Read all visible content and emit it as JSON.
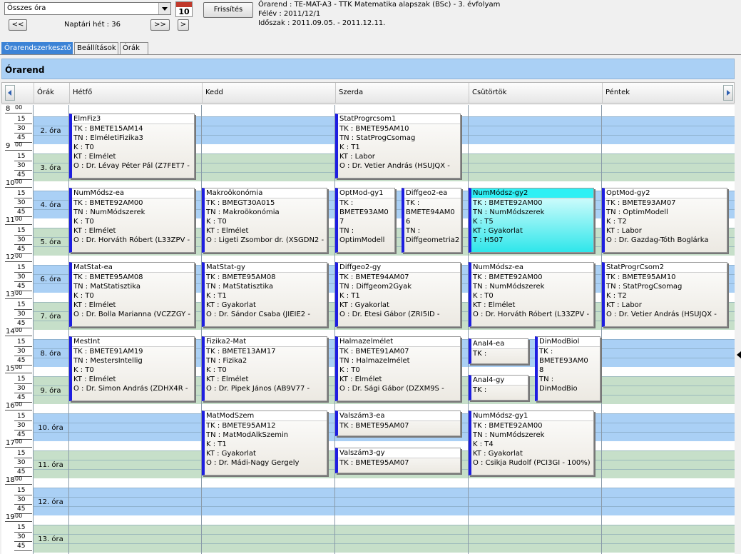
{
  "toolbar": {
    "filter_value": "Összes óra",
    "calendar_day": "10",
    "refresh_label": "Frissítés",
    "prev_label": "<<",
    "week_label": "Naptári hét : 36",
    "next_label": ">>",
    "next_small_label": ">"
  },
  "info": {
    "line1": "Órarend : TE-MAT-A3 - TTK Matematika alapszak (BSc) - 3. évfolyam",
    "line2": "Félév : 2011/12/1",
    "line3": "Időszak : 2011.09.05. - 2011.12.11."
  },
  "tabs": [
    "Órarendszerkesztő",
    "Beállítások",
    "Órák"
  ],
  "title": "Órarend",
  "header": {
    "col_orak": "Órák",
    "days": [
      "Hétfő",
      "Kedd",
      "Szerda",
      "Csütörtök",
      "Péntek"
    ]
  },
  "hours": [
    "8",
    "9",
    "10",
    "11",
    "12",
    "13",
    "14",
    "15",
    "16",
    "17",
    "18",
    "19"
  ],
  "minute_labels": {
    "zero": "00",
    "q1": "15",
    "q2": "30",
    "q3": "45"
  },
  "orak": [
    "2. óra",
    "3. óra",
    "4. óra",
    "5. óra",
    "6. óra",
    "7. óra",
    "8. óra",
    "9. óra",
    "10. óra",
    "11. óra",
    "12. óra",
    "13. óra"
  ],
  "colors": {
    "blue_band": "#aad0f5",
    "green_band": "#c6dfc9",
    "card_border": "#1e1ee0",
    "highlight": "#2ff0f4"
  },
  "cards": [
    {
      "title": "ElmFiz3",
      "lines": [
        "TK : BMETE15AM14",
        "TN : ElméletiFizika3",
        "K : T0",
        "KT : Elmélet",
        "O :  Dr. Lévay Péter Pál (Z7FET7 -"
      ]
    },
    {
      "title": "StatProgrcsom1",
      "lines": [
        "TK : BMETE95AM10",
        "TN : StatProgCsomag",
        "K : T1",
        "KT : Labor",
        "O :  Dr. Vetier András (HSUJQX -"
      ]
    },
    {
      "title": "NumMódsz-ea",
      "lines": [
        "TK : BMETE92AM00",
        "TN : NumMódszerek",
        "K : T0",
        "KT : Elmélet",
        "O :  Dr. Horváth Róbert (L33ZPV -"
      ]
    },
    {
      "title": "Makroökonómia",
      "lines": [
        "TK : BMEGT30A015",
        "TN : Makroökonómia",
        "K : T0",
        "KT : Elmélet",
        "O :  Ligeti Zsombor dr. (XSGDN2 -"
      ]
    },
    {
      "title": "OptMod-gy1",
      "lines": [
        "TK :",
        "BMETE93AM0",
        "7",
        "TN :",
        "OptimModell"
      ]
    },
    {
      "title": "Diffgeo2-ea",
      "lines": [
        "TK :",
        "BMETE94AM0",
        "6",
        "TN :",
        "Diffgeometria2"
      ]
    },
    {
      "title": "NumMódsz-gy2",
      "lines": [
        "TK : BMETE92AM00",
        "TN : NumMódszerek",
        "K : T5",
        "KT : Gyakorlat",
        "T : H507"
      ]
    },
    {
      "title": "OptMod-gy2",
      "lines": [
        "TK : BMETE93AM07",
        "TN : OptimModell",
        "K : T2",
        "KT : Labor",
        "O :  Dr. Gazdag-Tóth Boglárka"
      ]
    },
    {
      "title": "MatStat-ea",
      "lines": [
        "TK : BMETE95AM08",
        "TN : MatStatisztika",
        "K : T0",
        "KT : Elmélet",
        "O :  Dr. Bolla Marianna (VCZZGY -"
      ]
    },
    {
      "title": "MatStat-gy",
      "lines": [
        "TK : BMETE95AM08",
        "TN : MatStatisztika",
        "K : T1",
        "KT : Gyakorlat",
        "O :  Dr. Sándor Csaba (JIEIE2 -"
      ]
    },
    {
      "title": "Diffgeo2-gy",
      "lines": [
        "TK : BMETE94AM07",
        "TN : Diffgeom2Gyak",
        "K : T1",
        "KT : Gyakorlat",
        "O :  Dr. Etesi Gábor (ZRI5ID -"
      ]
    },
    {
      "title": "NumMódsz-ea",
      "lines": [
        "TK : BMETE92AM00",
        "TN : NumMódszerek",
        "K : T0",
        "KT : Elmélet",
        "O :  Dr. Horváth Róbert (L33ZPV -"
      ]
    },
    {
      "title": "StatProgrCsom2",
      "lines": [
        "TK : BMETE95AM10",
        "TN : StatProgCsomag",
        "K : T2",
        "KT : Labor",
        "O :  Dr. Vetier András (HSUJQX -"
      ]
    },
    {
      "title": "MestInt",
      "lines": [
        "TK : BMETE91AM19",
        "TN : MestersIntellig",
        "K : T0",
        "KT : Elmélet",
        "O :  Dr. Simon András (ZDHX4R -"
      ]
    },
    {
      "title": "Fizika2-Mat",
      "lines": [
        "TK : BMETE13AM17",
        "TN : Fizika2",
        "K : T0",
        "KT : Elmélet",
        "O :  Dr. Pipek János (AB9V77 -"
      ]
    },
    {
      "title": "Halmazelmélet",
      "lines": [
        "TK : BMETE91AM07",
        "TN : Halmazelmélet",
        "K : T0",
        "KT : Elmélet",
        "O :  Dr. Sági Gábor (DZXM9S -"
      ]
    },
    {
      "title": "Anal4-ea",
      "lines": [
        "TK :"
      ]
    },
    {
      "title": "DinModBiol",
      "lines": [
        "TK :",
        "BMETE93AM0",
        "8",
        "TN :",
        "DinModBio"
      ]
    },
    {
      "title": "Anal4-gy",
      "lines": [
        "TK :"
      ]
    },
    {
      "title": "MatModSzem",
      "lines": [
        "TK : BMETE95AM12",
        "TN : MatModAlkSzemin",
        "K : T1",
        "KT : Gyakorlat",
        "O :  Dr. Mádi-Nagy Gergely"
      ]
    },
    {
      "title": "Valszám3-ea",
      "lines": [
        "TK : BMETE95AM07"
      ]
    },
    {
      "title": "NumMódsz-gy1",
      "lines": [
        "TK : BMETE92AM00",
        "TN : NumMódszerek",
        "K : T4",
        "KT : Gyakorlat",
        "O :  Csikja Rudolf (PCI3GI - 100%)"
      ]
    },
    {
      "title": "Valszám3-gy",
      "lines": [
        "TK : BMETE95AM07"
      ]
    }
  ]
}
